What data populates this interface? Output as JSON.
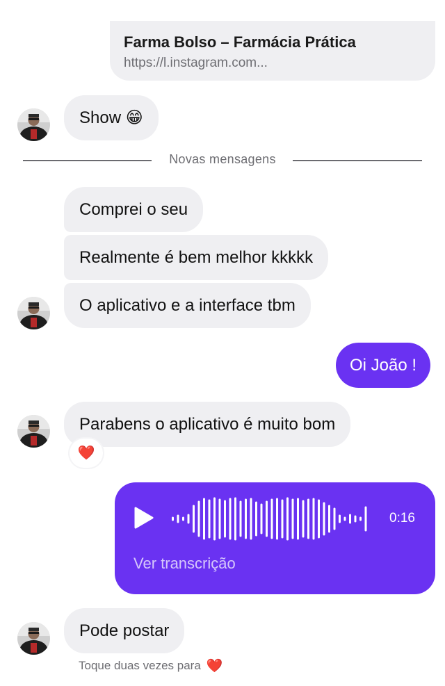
{
  "link_preview": {
    "title": "Farma Bolso – Farmácia Prática",
    "url": "https://l.instagram.com..."
  },
  "divider": {
    "label": "Novas mensagens"
  },
  "messages": [
    {
      "text": "Show 😁",
      "direction": "incoming"
    },
    {
      "text": "Comprei o seu",
      "direction": "incoming"
    },
    {
      "text": "Realmente é bem melhor kkkkk",
      "direction": "incoming"
    },
    {
      "text": "O aplicativo e a interface tbm",
      "direction": "incoming"
    },
    {
      "text": "Oi João !",
      "direction": "outgoing"
    },
    {
      "text": "Parabens o aplicativo é muito bom",
      "direction": "incoming",
      "reaction": "❤️"
    },
    {
      "text": "Pode postar",
      "direction": "incoming"
    }
  ],
  "voice_message": {
    "duration": "0:16",
    "transcription_link": "Ver transcrição",
    "color": "#6a32f2"
  },
  "hint": {
    "text": "Toque duas vezes para",
    "emoji": "❤️"
  },
  "colors": {
    "incoming_bubble": "#efeff2",
    "outgoing_bubble": "#6a32f2",
    "secondary_text": "#6d6d72"
  },
  "icons": {
    "play": "play-icon",
    "reaction": "heart-icon",
    "avatar": "user-avatar"
  }
}
